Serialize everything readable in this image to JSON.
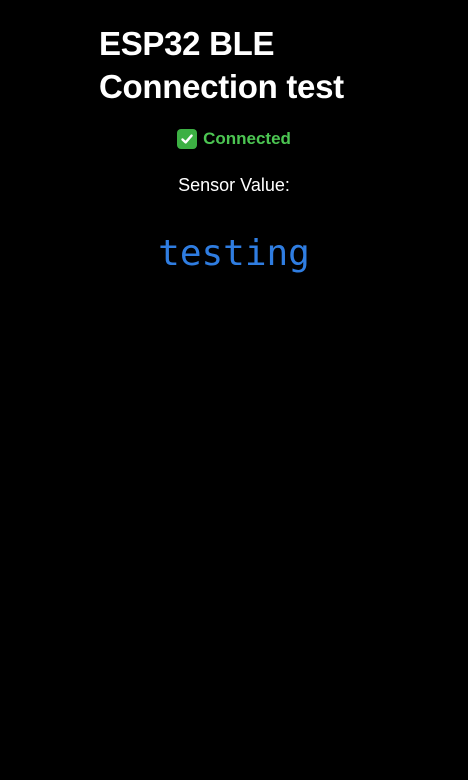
{
  "header": {
    "title_line1": "ESP32 BLE",
    "title_line2": "Connection test"
  },
  "status": {
    "icon": "check-mark-button-icon",
    "text": "Connected",
    "color": "#4cc552"
  },
  "sensor": {
    "label": "Sensor Value:",
    "value": "testing",
    "value_color": "#2f7de1"
  },
  "colors": {
    "background": "#000000",
    "text": "#ffffff"
  }
}
